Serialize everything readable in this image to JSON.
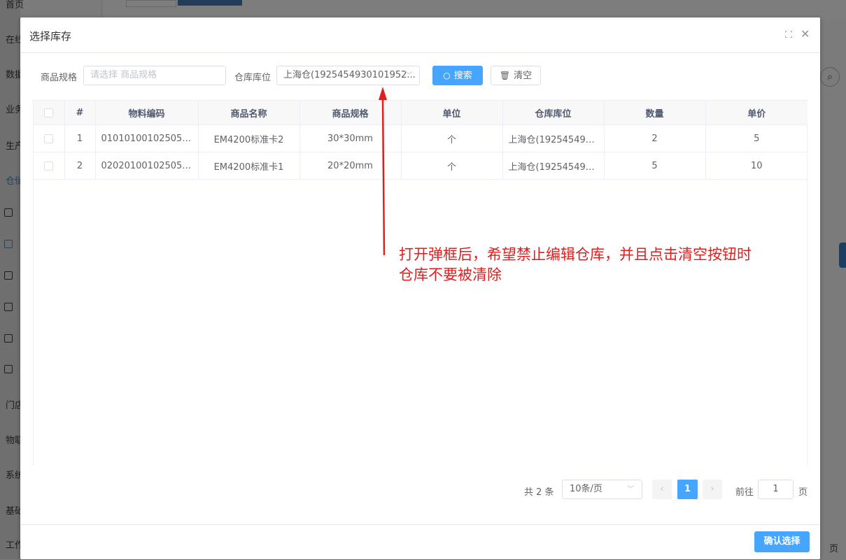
{
  "background": {
    "sidebar_items": [
      "首页",
      "在线",
      "数据",
      "业务",
      "生产",
      "仓储",
      "门店",
      "物联",
      "系统",
      "基础",
      "工作"
    ],
    "bottom_right_text": "页"
  },
  "dialog": {
    "title": "选择库存",
    "filters": {
      "spec_label": "商品规格",
      "spec_placeholder": "请选择 商品规格",
      "warehouse_label": "仓库库位",
      "warehouse_value": "上海仓(1925454930101952...",
      "search_label": "搜索",
      "clear_label": "清空"
    },
    "table": {
      "headers": [
        "#",
        "物料编码",
        "商品名称",
        "商品规格",
        "单位",
        "仓库库位",
        "数量",
        "单价"
      ],
      "rows": [
        {
          "index": "1",
          "code": "0101010010250522...",
          "name": "EM4200标准卡2",
          "spec": "30*30mm",
          "unit": "个",
          "location": "上海仓(1925454930...",
          "qty": "2",
          "price": "5"
        },
        {
          "index": "2",
          "code": "0202010010250522...",
          "name": "EM4200标准卡1",
          "spec": "20*20mm",
          "unit": "个",
          "location": "上海仓(1925454930...",
          "qty": "5",
          "price": "10"
        }
      ]
    },
    "pagination": {
      "total": "共 2 条",
      "page_size": "10条/页",
      "current_page": "1",
      "goto_label": "前往",
      "goto_value": "1",
      "page_suffix": "页"
    },
    "confirm_label": "确认选择"
  },
  "annotation": {
    "line1": "打开弹框后，希望禁止编辑仓库，并且点击清空按钮时",
    "line2": "仓库不要被清除",
    "color": "#e01e1e"
  }
}
